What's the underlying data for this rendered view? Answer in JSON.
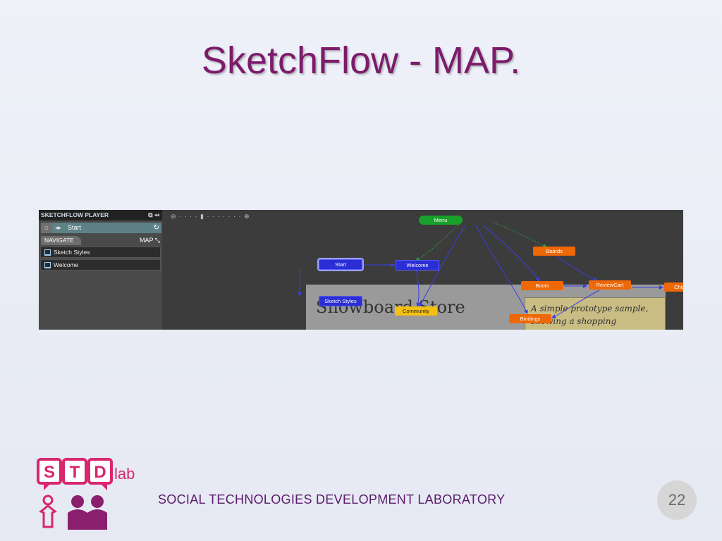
{
  "slide": {
    "title": "SketchFlow - MAP.",
    "footer": "SOCIAL  TECHNOLOGIES  DEVELOPMENT  LABORATORY",
    "page_number": "22",
    "logo": {
      "letters": [
        "S",
        "T",
        "D"
      ],
      "suffix": "lab",
      "color": "#d8266f",
      "people_color": "#8a1f6e"
    }
  },
  "player": {
    "header": "SKETCHFLOW PLAYER",
    "current_screen": "Start",
    "tab_navigate": "NAVIGATE",
    "tab_map": "MAP",
    "items": [
      "Sketch Styles",
      "Welcome"
    ]
  },
  "map": {
    "zoom_icons": [
      "zoom-out-icon",
      "zoom-in-icon"
    ],
    "nodes": {
      "menu": "Menu",
      "start": "Start",
      "welcome": "Welcome",
      "boards": "Boards",
      "boots": "Boots",
      "reviewcart": "ReviewCart",
      "checkout": "Checkout",
      "sketch_styles": "Sketch Styles",
      "community": "Community",
      "bindings": "Bindings"
    },
    "preview_title": "Snowboard Store",
    "preview_note": "A simple prototype sample, showing a shopping"
  },
  "colors": {
    "title": "#7d1b6b",
    "node_blue": "#2a2ed4",
    "node_orange": "#ee6808",
    "node_green": "#19a02a",
    "node_yellow": "#f4c014"
  }
}
